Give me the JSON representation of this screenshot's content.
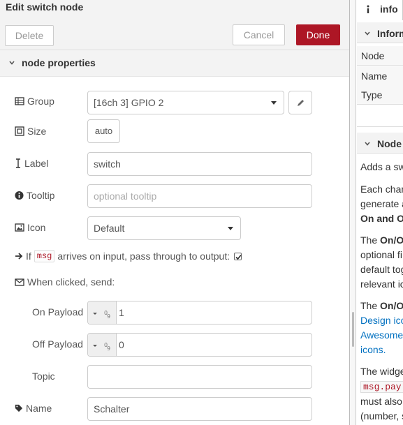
{
  "tray": {
    "title": "Edit switch node",
    "delete_label": "Delete",
    "cancel_label": "Cancel",
    "done_label": "Done",
    "section_title": "node properties"
  },
  "form": {
    "group_label": "Group",
    "group_value": "[16ch 3] GPIO 2",
    "size_label": "Size",
    "size_value": "auto",
    "label_label": "Label",
    "label_value": "switch",
    "tooltip_label": "Tooltip",
    "tooltip_placeholder": "optional tooltip",
    "icon_label": "Icon",
    "icon_value": "Default",
    "passthrough_prefix": "If",
    "passthrough_code": "msg",
    "passthrough_suffix": "arrives on input, pass through to output:",
    "passthrough_checked": true,
    "when_clicked_label": "When clicked, send:",
    "on_payload_label": "On Payload",
    "on_payload_value": "1",
    "off_payload_label": "Off Payload",
    "off_payload_value": "0",
    "topic_label": "Topic",
    "topic_value": "",
    "name_label": "Name",
    "name_value": "Schalter"
  },
  "sidebar": {
    "tab_label": "info",
    "info_section_title": "Inform",
    "info_rows": [
      "Node",
      "Name",
      "Type"
    ],
    "help_section_title": "Node",
    "help_lines": [
      "Adds a sw",
      "Each chan",
      "generate a",
      "On and O",
      "The On/O",
      "optional fi",
      "default tog",
      "relevant ic",
      "The On/O",
      "Design ico",
      "Awesome",
      "icons.",
      "The widge",
      "msg.pay",
      "must also",
      "(number, s"
    ]
  },
  "colors": {
    "accent": "#ad1625",
    "link": "#0070c0",
    "panel_bg": "#f3f3f3"
  }
}
